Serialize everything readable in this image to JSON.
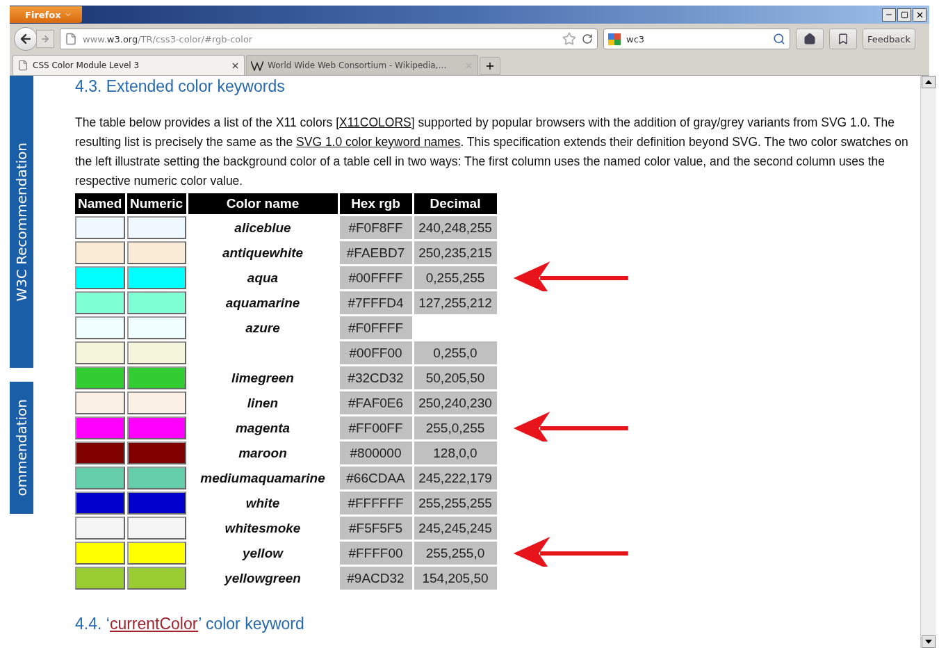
{
  "window": {
    "menu_button": "Firefox"
  },
  "toolbar": {
    "url": "www.**w3.org**/TR/css3-color/#rgb-color",
    "search_value": "wc3",
    "feedback_button": "Feedback"
  },
  "tabs": [
    {
      "title": "CSS Color Module Level 3",
      "selected": true
    },
    {
      "title": "World Wide Web Consortium - Wikipedia,…",
      "selected": false
    }
  ],
  "sidebar_labels": [
    "W3C Recommendation",
    "ommendation"
  ],
  "heading": "4.3. Extended color keywords",
  "paragraph": [
    {
      "kind": "text",
      "text": "The table below provides a list of the X11 colors "
    },
    {
      "kind": "link",
      "text": "[X11COLORS]"
    },
    {
      "kind": "text",
      "text": " supported by popular browsers with the addition of gray/grey variants from SVG 1.0. The resulting list is precisely the same as the "
    },
    {
      "kind": "link",
      "text": "SVG 1.0 color keyword names"
    },
    {
      "kind": "text",
      "text": ". This specification extends their definition beyond SVG. The two color swatches on the left illustrate setting the background color of a table cell in two ways: The first column uses the named color value, and the second column uses the respective numeric color value."
    }
  ],
  "table": {
    "columns": [
      "Named",
      "Numeric",
      "Color name",
      "Hex rgb",
      "Decimal"
    ],
    "rows": [
      {
        "color": "#f0f8ff",
        "name": "aliceblue",
        "hex": "#F0F8FF",
        "decimal": "240,248,255",
        "marked": false
      },
      {
        "color": "#faebd7",
        "name": "antiquewhite",
        "hex": "#FAEBD7",
        "decimal": "250,235,215",
        "marked": false
      },
      {
        "color": "#00ffff",
        "name": "aqua",
        "hex": "#00FFFF",
        "decimal": "0,255,255",
        "marked": true
      },
      {
        "color": "#7fffd4",
        "name": "aquamarine",
        "hex": "#7FFFD4",
        "decimal": "127,255,212",
        "marked": false
      },
      {
        "color": "#f0ffff",
        "name": "azure",
        "hex": "#F0FFFF",
        "marked": false
      },
      {
        "color": "#f5f5dc",
        "hex": "#00FF00",
        "decimal": "0,255,0",
        "marked": false
      },
      {
        "color": "#32cd32",
        "name": "limegreen",
        "hex": "#32CD32",
        "decimal": "50,205,50",
        "marked": false
      },
      {
        "color": "#faf0e6",
        "name": "linen",
        "hex": "#FAF0E6",
        "decimal": "250,240,230",
        "marked": false
      },
      {
        "color": "#ff00ff",
        "name": "magenta",
        "hex": "#FF00FF",
        "decimal": "255,0,255",
        "marked": true
      },
      {
        "color": "#800000",
        "name": "maroon",
        "hex": "#800000",
        "decimal": "128,0,0",
        "marked": false
      },
      {
        "color": "#66cdaa",
        "name": "mediumaquamarine",
        "hex": "#66CDAA",
        "decimal": "245,222,179",
        "marked": false
      },
      {
        "color": "#0000cd",
        "name": "white",
        "hex": "#FFFFFF",
        "decimal": "255,255,255",
        "marked": false
      },
      {
        "color": "#f5f5f5",
        "name": "whitesmoke",
        "hex": "#F5F5F5",
        "decimal": "245,245,245",
        "marked": false
      },
      {
        "color": "#ffff00",
        "name": "yellow",
        "hex": "#FFFF00",
        "decimal": "255,255,0",
        "marked": true
      },
      {
        "color": "#9acd32",
        "name": "yellowgreen",
        "hex": "#9ACD32",
        "decimal": "154,205,50",
        "marked": false
      }
    ]
  },
  "next_heading": [
    {
      "kind": "text",
      "text": "4.4. ‘"
    },
    {
      "kind": "link",
      "text": "currentColor"
    },
    {
      "kind": "text",
      "text": "’ color keyword"
    }
  ]
}
